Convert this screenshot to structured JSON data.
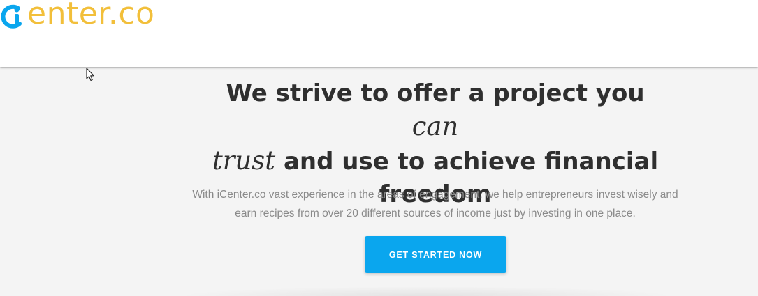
{
  "header": {
    "logo_text": "enter.co",
    "logo_colors": {
      "mark": "#0aa6ee",
      "text": "#f2bf3a"
    }
  },
  "hero": {
    "headline_part1": "We strive to offer a project you ",
    "headline_accent1": "can",
    "headline_accent2": "trust",
    "headline_part2": " and use to achieve financial freedom",
    "subtitle": "With iCenter.co vast experience in the areas of engagement, we help entrepreneurs invest wisely and earn recipes from over 20 different sources of income just by investing in one place.",
    "cta_label": "GET STARTED NOW"
  },
  "colors": {
    "header_bg": "#ffffff",
    "page_bg": "#f4f4f4",
    "headline": "#2f2f2f",
    "subtitle": "#8a8a8a",
    "cta_bg": "#0aa6ee"
  },
  "icons": [
    "logo-mark-icon",
    "mouse-cursor-icon"
  ]
}
